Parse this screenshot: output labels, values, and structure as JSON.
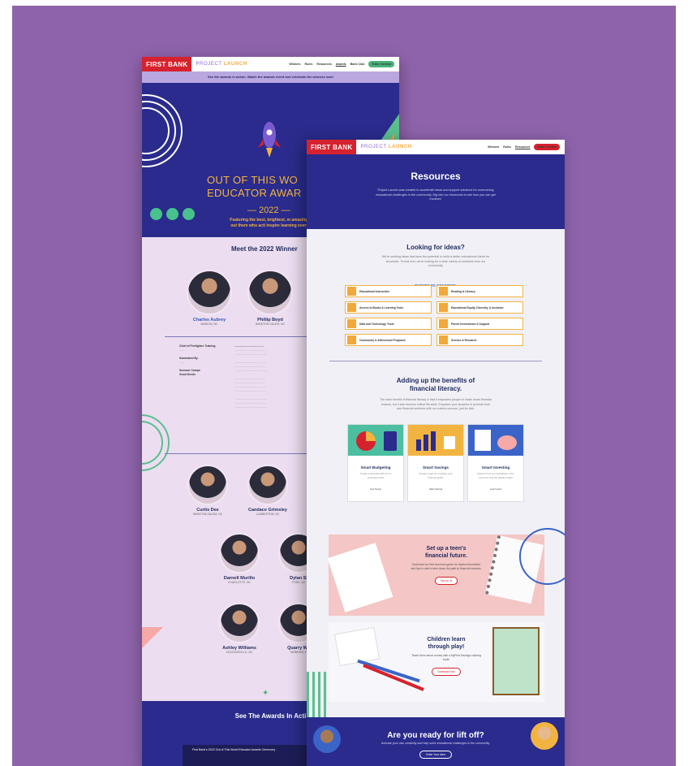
{
  "back_page": {
    "nav": {
      "brand": "FIRST BANK",
      "project": "PROJECT ",
      "project_accent": "LAUNCH",
      "links": [
        "Winners",
        "Rules",
        "Resources",
        "Awards",
        "Bank Club"
      ],
      "cta": "Enter Contest"
    },
    "banner": "See the awards in action. Watch the awards event and celebrate the winners now!",
    "hero": {
      "title_line1": "OUT OF THIS WO",
      "title_line2": "EDUCATOR AWAR",
      "year": "2022",
      "tagline": "Featuring the best, brightest, m amazing stars out there who acti inspire learning every day!"
    },
    "winners_title": "Meet the 2022 Winner",
    "winners": [
      {
        "name": "Charles Aubrey",
        "location": "MARION, NC"
      },
      {
        "name": "Phillip Boyd",
        "location": "WINSTON SALEM, NC"
      },
      {
        "name": "Curtis Dee",
        "location": "WINSTON-SALEM, NC"
      },
      {
        "name": "Candace Grimsley",
        "location": "LUMBERTON, NC"
      },
      {
        "name": "Darnell Murillo",
        "location": "CHARLOTTE, NC"
      },
      {
        "name": "Dylan Si",
        "location": "YORK, SC"
      },
      {
        "name": "Ashley Williams",
        "location": "JACKSONVILLE, NC"
      },
      {
        "name": "Quarry Wil",
        "location": "TARBORO, N"
      }
    ],
    "detail": {
      "role": "Chief of Firefighter Training",
      "nominated_by": "Nominated By",
      "summer_camps": "Summer Camps",
      "good_deeds": "Good Deeds"
    },
    "awards_title": "See The Awards In Acti",
    "video_title": "First Bank's 2022 Out of This World Educator Awards Ceremony"
  },
  "front_page": {
    "nav": {
      "brand": "FIRST BANK",
      "project": "PROJECT ",
      "project_accent": "LAUNCH",
      "links": [
        "Winners",
        "Rules",
        "Resources"
      ],
      "cta": "Enter Contest"
    },
    "hero": {
      "title": "Resources",
      "description": "Project Launch was created to accelerate ideas and support solutions for overcoming educational challenges in the community. Dig into our resources to see how you can get involved."
    },
    "ideas": {
      "title": "Looking for ideas?",
      "description": "We're seeking ideas that have the potential to build a better educational future for all people. To that end, we're looking for a wide variety of solutions from our community.",
      "themes_title": "THEMES TO CONSIDER:",
      "themes": [
        "Educational Instruction",
        "Reading & Literacy",
        "Access to Books & Learning Tools",
        "Educational Equity, Diversity, & Inclusion",
        "Data and Technology Tools",
        "Parent Involvement & Support",
        "Community & Afterschool Programs",
        "Science & Research"
      ]
    },
    "financial": {
      "title_line1": "Adding up the benefits of",
      "title_line2": "financial literacy.",
      "description": "The main benefit of financial literacy is that it empowers people to make smart financial choices, but it also teaches critical life skills. Empower your students to promote their own financial wellness with our custom courses, just for kids.",
      "cards": [
        {
          "title": "Smart Budgeting",
          "text": "Create a financial path for an empowered life",
          "link": "Get Going"
        },
        {
          "title": "Smart Savings",
          "text": "Create a plan for reaching your financial goals",
          "link": "Start Saving"
        },
        {
          "title": "Smart Investing",
          "text": "Explore how you participate in the economy and the global market",
          "link": "Learn How"
        }
      ]
    },
    "teen": {
      "title_line1": "Set up a teen's",
      "title_line2": "financial future.",
      "description": "Download our free brochure guide for helpful information and tips to start a teen down the path to financial success.",
      "button": "Tips for Ts"
    },
    "play": {
      "title_line1": "Children learn",
      "title_line2": "through play!",
      "description": "Teach them about money with a MyFirst Savings coloring book!",
      "button": "Download Now"
    },
    "lift": {
      "title": "Are you ready for lift off?",
      "description": "Activate your own creativity and help solve educational challenges in the community.",
      "button": "Enter Your Idea"
    }
  },
  "colors": {
    "backdrop": "#8e63ab",
    "navy": "#2a2b8c",
    "brand_red": "#d6222e",
    "gold": "#f2b441",
    "green": "#47b27a"
  }
}
